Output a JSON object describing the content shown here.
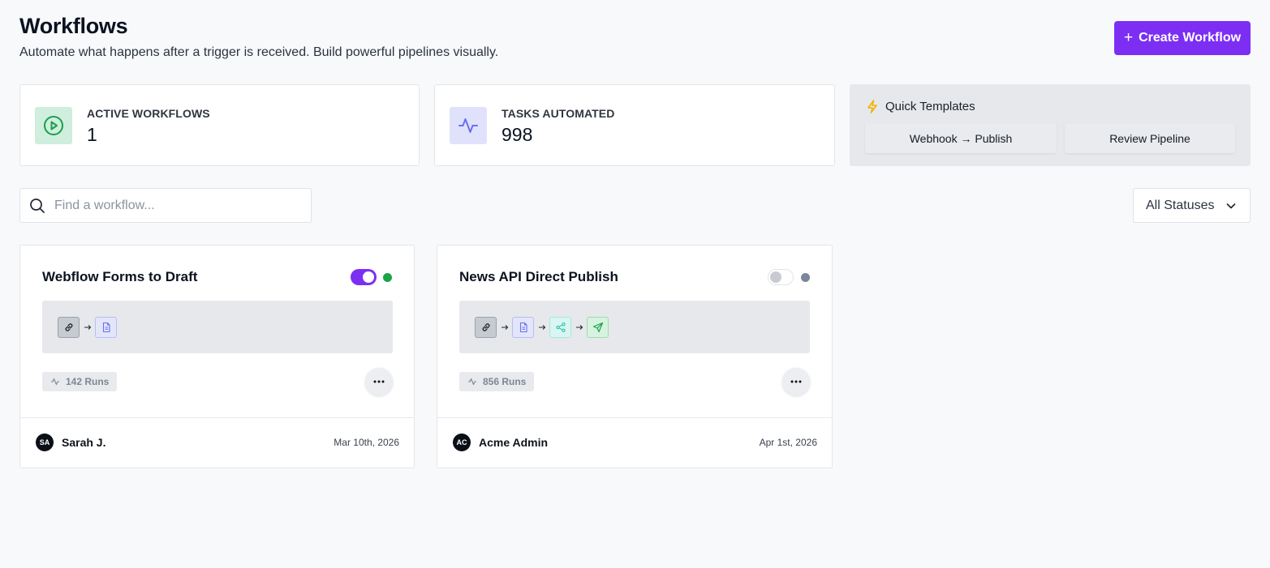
{
  "header": {
    "title": "Workflows",
    "subtitle": "Automate what happens after a trigger is received. Build powerful pipelines visually.",
    "create_label": "Create Workflow"
  },
  "stats": [
    {
      "label": "ACTIVE WORKFLOWS",
      "value": "1",
      "icon": "play-circle-icon"
    },
    {
      "label": "TASKS AUTOMATED",
      "value": "998",
      "icon": "activity-icon"
    }
  ],
  "templates": {
    "title": "Quick Templates",
    "items": [
      "Webhook → Publish",
      "Review Pipeline"
    ]
  },
  "search": {
    "placeholder": "Find a workflow...",
    "value": ""
  },
  "status_filter": {
    "selected": "All Statuses"
  },
  "workflows": [
    {
      "title": "Webflow Forms to Draft",
      "enabled": true,
      "status_color": "#1aa34a",
      "steps": [
        "link-icon",
        "document-icon"
      ],
      "runs": "142 Runs",
      "owner_initials": "SA",
      "owner": "Sarah J.",
      "date": "Mar 10th, 2026"
    },
    {
      "title": "News API Direct Publish",
      "enabled": false,
      "status_color": "#7c8698",
      "steps": [
        "link-icon",
        "document-icon",
        "share-icon",
        "send-icon"
      ],
      "runs": "856 Runs",
      "owner_initials": "AC",
      "owner": "Acme Admin",
      "date": "Apr 1st, 2026"
    }
  ],
  "colors": {
    "accent": "#7c2ff3",
    "active": "#1aa34a",
    "inactive": "#7c8698",
    "template_icon": "#f2b300"
  }
}
